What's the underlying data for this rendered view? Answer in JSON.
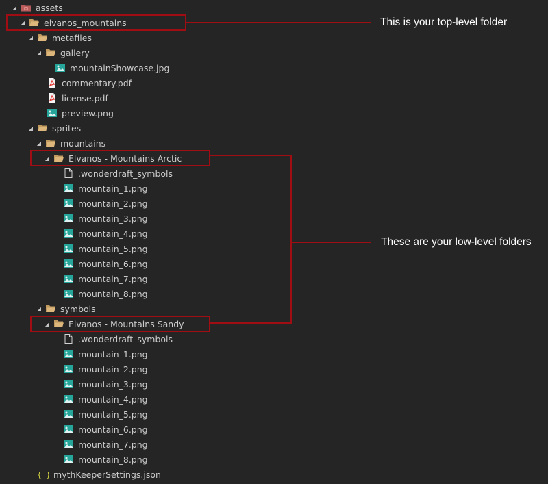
{
  "tree": [
    {
      "label": "assets",
      "icon": "assets-folder-icon",
      "twisty": "expanded"
    },
    {
      "label": "elvanos_mountains",
      "icon": "folder-icon",
      "twisty": "expanded"
    },
    {
      "label": "metafiles",
      "icon": "folder-icon",
      "twisty": "expanded"
    },
    {
      "label": "gallery",
      "icon": "folder-icon",
      "twisty": "expanded"
    },
    {
      "label": "mountainShowcase.jpg",
      "icon": "image-file-icon",
      "twisty": ""
    },
    {
      "label": "commentary.pdf",
      "icon": "pdf-file-icon",
      "twisty": ""
    },
    {
      "label": "license.pdf",
      "icon": "pdf-file-icon",
      "twisty": ""
    },
    {
      "label": "preview.png",
      "icon": "image-file-icon",
      "twisty": ""
    },
    {
      "label": "sprites",
      "icon": "folder-icon",
      "twisty": "expanded"
    },
    {
      "label": "mountains",
      "icon": "folder-icon",
      "twisty": "expanded"
    },
    {
      "label": "Elvanos - Mountains Arctic",
      "icon": "folder-icon",
      "twisty": "expanded"
    },
    {
      "label": ".wonderdraft_symbols",
      "icon": "text-file-icon",
      "twisty": ""
    },
    {
      "label": "mountain_1.png",
      "icon": "image-file-icon",
      "twisty": ""
    },
    {
      "label": "mountain_2.png",
      "icon": "image-file-icon",
      "twisty": ""
    },
    {
      "label": "mountain_3.png",
      "icon": "image-file-icon",
      "twisty": ""
    },
    {
      "label": "mountain_4.png",
      "icon": "image-file-icon",
      "twisty": ""
    },
    {
      "label": "mountain_5.png",
      "icon": "image-file-icon",
      "twisty": ""
    },
    {
      "label": "mountain_6.png",
      "icon": "image-file-icon",
      "twisty": ""
    },
    {
      "label": "mountain_7.png",
      "icon": "image-file-icon",
      "twisty": ""
    },
    {
      "label": "mountain_8.png",
      "icon": "image-file-icon",
      "twisty": ""
    },
    {
      "label": "symbols",
      "icon": "folder-icon",
      "twisty": "expanded"
    },
    {
      "label": "Elvanos - Mountains Sandy",
      "icon": "folder-icon",
      "twisty": "expanded"
    },
    {
      "label": ".wonderdraft_symbols",
      "icon": "text-file-icon",
      "twisty": ""
    },
    {
      "label": "mountain_1.png",
      "icon": "image-file-icon",
      "twisty": ""
    },
    {
      "label": "mountain_2.png",
      "icon": "image-file-icon",
      "twisty": ""
    },
    {
      "label": "mountain_3.png",
      "icon": "image-file-icon",
      "twisty": ""
    },
    {
      "label": "mountain_4.png",
      "icon": "image-file-icon",
      "twisty": ""
    },
    {
      "label": "mountain_5.png",
      "icon": "image-file-icon",
      "twisty": ""
    },
    {
      "label": "mountain_6.png",
      "icon": "image-file-icon",
      "twisty": ""
    },
    {
      "label": "mountain_7.png",
      "icon": "image-file-icon",
      "twisty": ""
    },
    {
      "label": "mountain_8.png",
      "icon": "image-file-icon",
      "twisty": ""
    },
    {
      "label": "mythKeeperSettings.json",
      "icon": "json-file-icon",
      "twisty": ""
    }
  ],
  "annotations": {
    "top_level": "This is your top-level folder",
    "low_level": "These are your low-level folders"
  },
  "colors": {
    "background": "#252526",
    "text": "#cccccc",
    "highlight": "#a00d13",
    "folder": "#dcb67a",
    "image": "#26a69a",
    "pdf": "#e53935",
    "json": "#cbcb41"
  }
}
